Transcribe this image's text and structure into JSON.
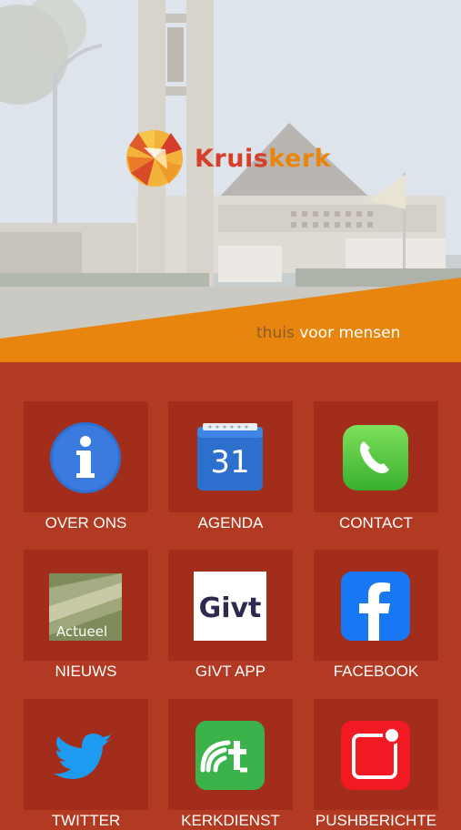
{
  "brand": {
    "name_first": "Kruis",
    "name_second": "kerk",
    "tagline_first": "thuis",
    "tagline_second": " voor mensen"
  },
  "tiles": [
    {
      "label": "OVER ONS",
      "icon": "info-icon"
    },
    {
      "label": "AGENDA",
      "icon": "calendar-icon",
      "icon_text": "31"
    },
    {
      "label": "CONTACT",
      "icon": "phone-icon"
    },
    {
      "label": "NIEUWS",
      "icon": "news-icon",
      "icon_text": "Actueel"
    },
    {
      "label": "GIVT APP",
      "icon": "givt-icon",
      "icon_text": "Givt"
    },
    {
      "label": "FACEBOOK",
      "icon": "facebook-icon"
    },
    {
      "label": "TWITTER",
      "icon": "twitter-icon"
    },
    {
      "label": "KERKDIENST",
      "icon": "kerkdienst-icon"
    },
    {
      "label": "PUSHBERICHTE",
      "icon": "push-notification-icon"
    }
  ],
  "colors": {
    "background": "#b23a22",
    "tile": "#a22d1b",
    "accent_orange": "#e8850f",
    "brand_red": "#d6402a"
  }
}
